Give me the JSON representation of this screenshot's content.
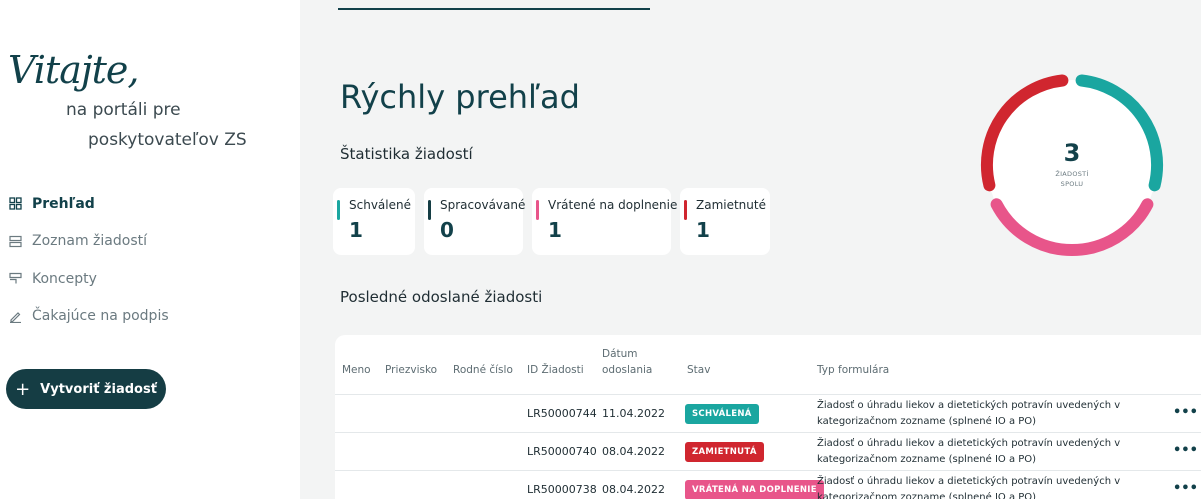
{
  "sidebar": {
    "welcome": "Vitajte,",
    "subtitle_line1": "na portáli pre",
    "subtitle_line2": "poskytovateľov ZS",
    "items": [
      {
        "label": "Prehľad",
        "icon": "grid-icon",
        "active": true
      },
      {
        "label": "Zoznam žiadostí",
        "icon": "list-icon",
        "active": false
      },
      {
        "label": "Koncepty",
        "icon": "drafts-icon",
        "active": false
      },
      {
        "label": "Čakajúce na podpis",
        "icon": "pen-icon",
        "active": false
      }
    ],
    "create_button": {
      "plus": "+",
      "label": "Vytvoriť žiadosť"
    }
  },
  "main": {
    "title": "Rýchly prehľad",
    "stats_title": "Štatistika žiadostí",
    "cards": [
      {
        "label": "Schválené",
        "value": "1",
        "color": "#1aa6a0"
      },
      {
        "label": "Spracovávané",
        "value": "0",
        "color": "#153d44"
      },
      {
        "label": "Vrátené na doplnenie",
        "value": "1",
        "color": "#e8558a"
      },
      {
        "label": "Zamietnuté",
        "value": "1",
        "color": "#d0262f"
      }
    ],
    "donut": {
      "total": "3",
      "label_line1": "ŽIADOSTÍ",
      "label_line2": "SPOLU"
    },
    "recent_title": "Posledné odoslané žiadosti",
    "table": {
      "headers": {
        "meno": "Meno",
        "priezvisko": "Priezvisko",
        "rodne_cislo": "Rodné číslo",
        "id": "ID Žiadosti",
        "datum_1": "Dátum",
        "datum_2": "odoslania",
        "stav": "Stav",
        "typ": "Typ formulára"
      },
      "rows": [
        {
          "id": "LR50000744",
          "date": "11.04.2022",
          "status": "SCHVÁLENÁ",
          "status_color": "#1aa6a0",
          "typ1": "Žiadosť o úhradu liekov a dietetických potravín uvedených v",
          "typ2": "kategorizačnom zozname (splnené IO a PO)",
          "more": "•••"
        },
        {
          "id": "LR50000740",
          "date": "08.04.2022",
          "status": "ZAMIETNUTÁ",
          "status_color": "#d0262f",
          "typ1": "Žiadosť o úhradu liekov a dietetických potravín uvedených v",
          "typ2": "kategorizačnom zozname (splnené IO a PO)",
          "more": "•••"
        },
        {
          "id": "LR50000738",
          "date": "08.04.2022",
          "status": "VRÁTENÁ NA DOPLNENIE",
          "status_color": "#e8558a",
          "typ1": "Žiadosť o úhradu liekov a dietetických potravín uvedených v",
          "typ2": "kategorizačnom zozname (splnené IO a PO)",
          "more": "•••"
        }
      ]
    }
  }
}
